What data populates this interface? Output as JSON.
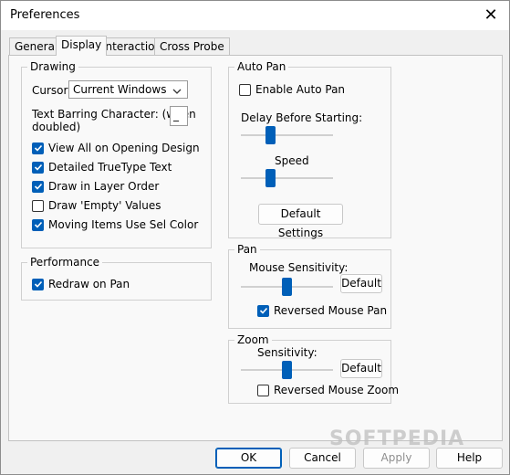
{
  "window": {
    "title": "Preferences",
    "close_glyph": "✕"
  },
  "tabs": [
    {
      "label": "General"
    },
    {
      "label": "Display"
    },
    {
      "label": "Interaction"
    },
    {
      "label": "Cross Probe"
    }
  ],
  "drawing": {
    "title": "Drawing",
    "cursor_label": "Cursor:",
    "cursor_value": "Current Windows",
    "text_barring_label_line1": "Text Barring Character: (when",
    "text_barring_label_line2": "doubled)",
    "text_barring_value": "_",
    "options": [
      {
        "label": "View All on Opening Design",
        "checked": true
      },
      {
        "label": "Detailed TrueType Text",
        "checked": true
      },
      {
        "label": "Draw in Layer Order",
        "checked": true
      },
      {
        "label": "Draw 'Empty' Values",
        "checked": false
      },
      {
        "label": "Moving Items Use Sel Color",
        "checked": true
      }
    ]
  },
  "performance": {
    "title": "Performance",
    "redraw_label": "Redraw on Pan",
    "redraw_checked": true
  },
  "auto_pan": {
    "title": "Auto Pan",
    "enable_label": "Enable Auto Pan",
    "enable_checked": false,
    "delay_label": "Delay Before Starting:",
    "delay_level": 0.3,
    "speed_label": "Speed",
    "speed_level": 0.3,
    "default_button": "Default Settings"
  },
  "pan": {
    "title": "Pan",
    "sensitivity_label": "Mouse Sensitivity:",
    "sensitivity_level": 0.5,
    "default_button": "Default",
    "reversed_label": "Reversed Mouse Pan",
    "reversed_checked": true
  },
  "zoom": {
    "title": "Zoom",
    "sensitivity_label": "Sensitivity:",
    "sensitivity_level": 0.5,
    "default_button": "Default",
    "reversed_label": "Reversed Mouse Zoom",
    "reversed_checked": false
  },
  "footer": {
    "ok": "OK",
    "cancel": "Cancel",
    "apply": "Apply",
    "help": "Help"
  },
  "watermark": "SOFTPEDIA",
  "colors": {
    "accent": "#005fb8"
  }
}
